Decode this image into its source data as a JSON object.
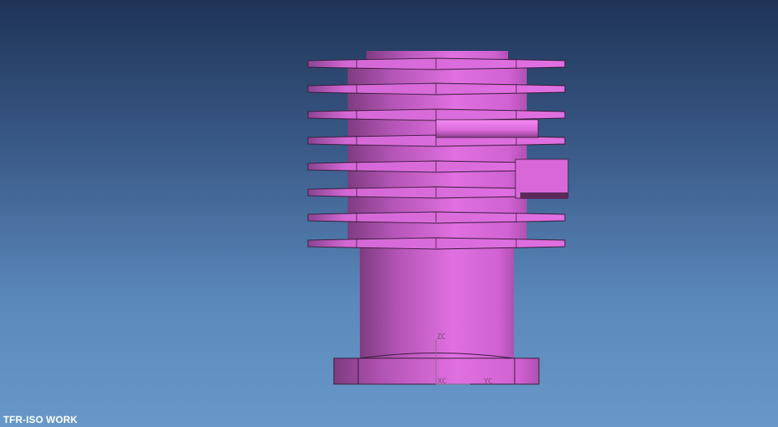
{
  "viewport": {
    "view_name": "TFR-ISO WORK",
    "background_top": "#1f3457",
    "background_bottom": "#6898c7"
  },
  "model": {
    "color": "#d86ad8",
    "shadow_color": "#7e3c80",
    "edge_color": "#3a1a3a"
  },
  "wcs": {
    "z_label": "ZC",
    "x_label": "XC",
    "y_label": "YC"
  }
}
